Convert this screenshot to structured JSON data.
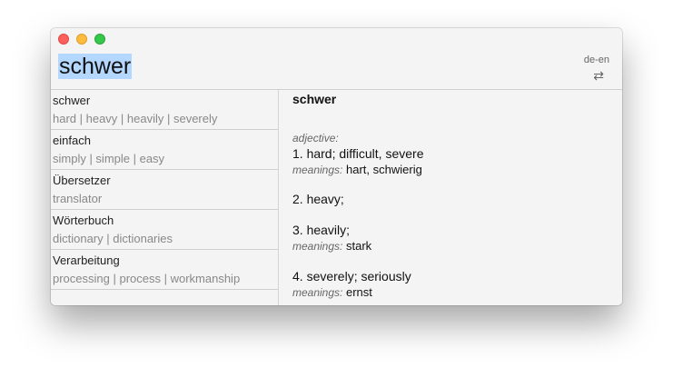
{
  "search": {
    "query": "schwer"
  },
  "header": {
    "language": "de-en",
    "swap_icon": "⇄"
  },
  "results": [
    {
      "word": "schwer",
      "translations": "hard | heavy | heavily | severely"
    },
    {
      "word": "einfach",
      "translations": "simply | simple | easy"
    },
    {
      "word": "Übersetzer",
      "translations": "translator"
    },
    {
      "word": "Wörterbuch",
      "translations": "dictionary | dictionaries"
    },
    {
      "word": "Verarbeitung",
      "translations": "processing | process | workmanship"
    }
  ],
  "detail": {
    "headword": "schwer",
    "part_of_speech": "adjective:",
    "meanings_label": "meanings:",
    "senses": [
      {
        "text": "1. hard; difficult, severe",
        "meanings": "hart, schwierig"
      },
      {
        "text": "2. heavy;",
        "meanings": ""
      },
      {
        "text": "3. heavily;",
        "meanings": "stark"
      },
      {
        "text": "4. severely; seriously",
        "meanings": "ernst"
      }
    ]
  }
}
